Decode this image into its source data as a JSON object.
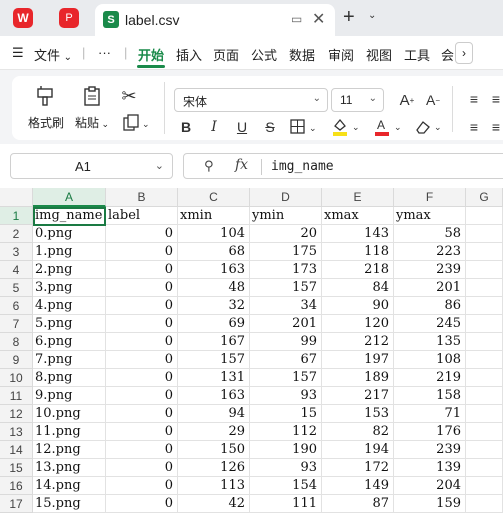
{
  "titlebar": {
    "wps_logo": "W",
    "pdf_logo": "P",
    "tab_title": "label.csv",
    "tab_icon_letter": "S"
  },
  "menu": {
    "file": "文件",
    "items": [
      "开始",
      "插入",
      "页面",
      "公式",
      "数据",
      "审阅",
      "视图",
      "工具",
      "会"
    ],
    "active": "开始"
  },
  "ribbon": {
    "format_painter": "格式刷",
    "paste": "粘贴",
    "font_name": "宋体",
    "font_size": "11"
  },
  "formula_bar": {
    "cell_ref": "A1",
    "fx": "fx",
    "value": "img_name"
  },
  "sheet": {
    "columns": [
      "A",
      "B",
      "C",
      "D",
      "E",
      "F",
      "G"
    ],
    "row_numbers": [
      "1",
      "2",
      "3",
      "4",
      "5",
      "6",
      "7",
      "8",
      "9",
      "10",
      "11",
      "12",
      "13",
      "14",
      "15",
      "16",
      "17"
    ],
    "rows": [
      [
        "img_name",
        "label",
        "xmin",
        "ymin",
        "xmax",
        "ymax"
      ],
      [
        "0.png",
        "0",
        "104",
        "20",
        "143",
        "58"
      ],
      [
        "1.png",
        "0",
        "68",
        "175",
        "118",
        "223"
      ],
      [
        "2.png",
        "0",
        "163",
        "173",
        "218",
        "239"
      ],
      [
        "3.png",
        "0",
        "48",
        "157",
        "84",
        "201"
      ],
      [
        "4.png",
        "0",
        "32",
        "34",
        "90",
        "86"
      ],
      [
        "5.png",
        "0",
        "69",
        "201",
        "120",
        "245"
      ],
      [
        "6.png",
        "0",
        "167",
        "99",
        "212",
        "135"
      ],
      [
        "7.png",
        "0",
        "157",
        "67",
        "197",
        "108"
      ],
      [
        "8.png",
        "0",
        "131",
        "157",
        "189",
        "219"
      ],
      [
        "9.png",
        "0",
        "163",
        "93",
        "217",
        "158"
      ],
      [
        "10.png",
        "0",
        "94",
        "15",
        "153",
        "71"
      ],
      [
        "11.png",
        "0",
        "29",
        "112",
        "82",
        "176"
      ],
      [
        "12.png",
        "0",
        "150",
        "190",
        "194",
        "239"
      ],
      [
        "13.png",
        "0",
        "126",
        "93",
        "172",
        "139"
      ],
      [
        "14.png",
        "0",
        "113",
        "154",
        "149",
        "204"
      ],
      [
        "15.png",
        "0",
        "42",
        "111",
        "87",
        "159"
      ]
    ]
  },
  "colors": {
    "accent": "#1a8a4a",
    "wps_red": "#e8262b",
    "selection_border": "#1a7a43"
  }
}
